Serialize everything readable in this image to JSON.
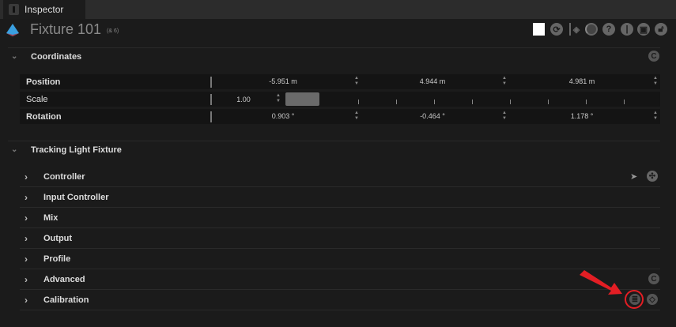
{
  "tab": {
    "label": "Inspector"
  },
  "header": {
    "title": "Fixture 101",
    "subtitle": "(& 6)",
    "icons": [
      "color-swatch",
      "refresh",
      "tag",
      "record",
      "help",
      "info",
      "snapshot",
      "lock"
    ]
  },
  "coordinates": {
    "title": "Coordinates",
    "position": {
      "label": "Position",
      "values": [
        "-5.951 m",
        "4.944 m",
        "4.981 m"
      ]
    },
    "scale": {
      "label": "Scale",
      "value": "1.00",
      "slider_fraction": 0.09
    },
    "rotation": {
      "label": "Rotation",
      "values": [
        "0.903 °",
        "-0.464 °",
        "1.178 °"
      ]
    }
  },
  "tracking": {
    "title": "Tracking Light Fixture",
    "items": [
      {
        "label": "Controller"
      },
      {
        "label": "Input Controller"
      },
      {
        "label": "Mix"
      },
      {
        "label": "Output"
      },
      {
        "label": "Profile"
      },
      {
        "label": "Advanced"
      },
      {
        "label": "Calibration"
      }
    ]
  },
  "colors": {
    "highlight": "#e31e24",
    "accent": "#3aa0e0"
  }
}
